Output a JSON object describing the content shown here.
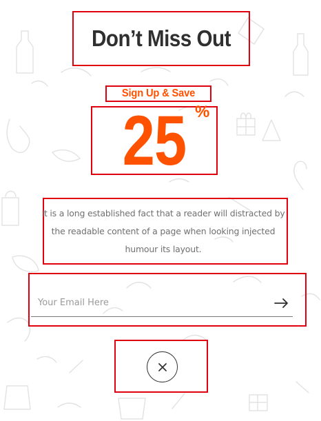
{
  "popup": {
    "title": "Don’t Miss Out",
    "subtitle": "Sign Up & Save",
    "discount": {
      "value": "25",
      "unit": "%"
    },
    "description": "It is a long established fact that a reader will distracted by the readable content of a page when looking injected humour its layout.",
    "email": {
      "value": "",
      "placeholder": "Your Email Here"
    },
    "icons": {
      "submit": "arrow-right-icon",
      "close": "close-icon"
    }
  },
  "colors": {
    "accent": "#ff5200",
    "title": "#2f2f2f",
    "description": "#707070",
    "annotation_border": "#e0000d",
    "background": "#ffffff"
  }
}
